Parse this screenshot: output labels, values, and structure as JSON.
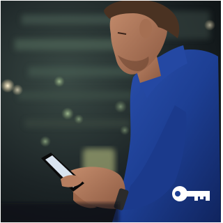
{
  "photo": {
    "subject": "man-looking-at-smartphone-at-night",
    "colors": {
      "background_dark": "#0f1416",
      "jacket_blue": "#1d3f94",
      "skin": "#b07a5e",
      "hair": "#4a3222",
      "phone_screen": "#d9e4f0",
      "bokeh_warm": "#f1d9a6",
      "bokeh_green": "#7f9a6a"
    }
  },
  "overlay": {
    "icon": "key-icon",
    "color": "#ffffff"
  }
}
